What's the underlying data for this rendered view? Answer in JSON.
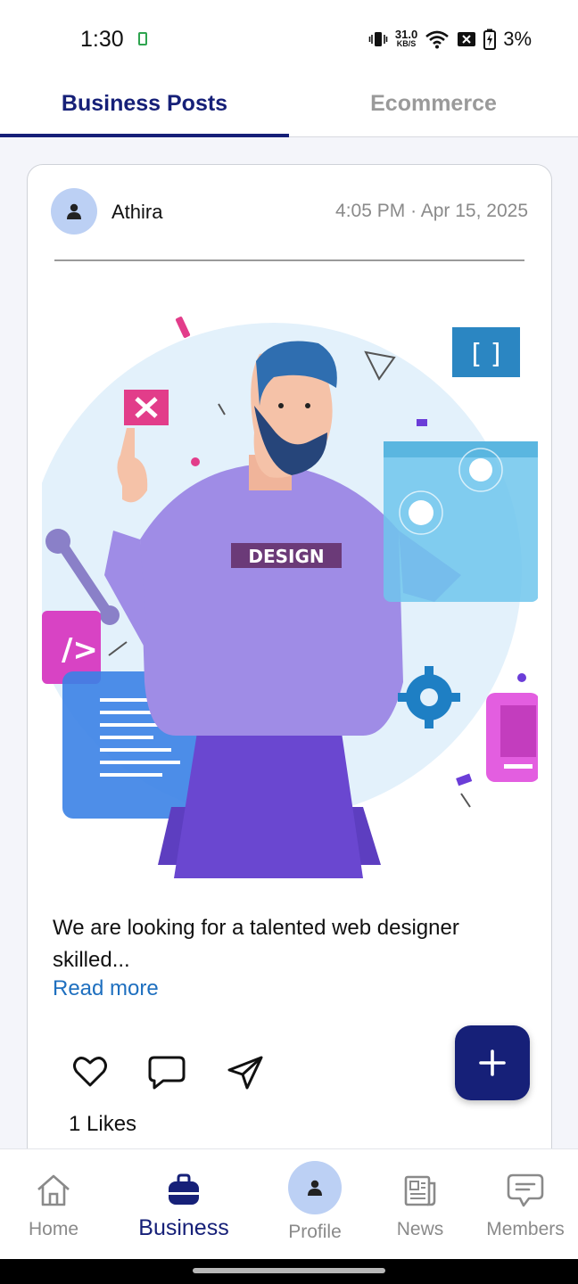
{
  "status_bar": {
    "time": "1:30",
    "net_speed_value": "31.0",
    "net_speed_unit": "KB/S",
    "battery": "3%"
  },
  "tabs": [
    {
      "label": "Business Posts",
      "active": true
    },
    {
      "label": "Ecommerce",
      "active": false
    }
  ],
  "post": {
    "author": "Athira",
    "timestamp": "4:05 PM · Apr 15, 2025",
    "image_badge_text": "DESIGN",
    "body": "We are looking for a talented web designer skilled...",
    "read_more": "Read more",
    "likes": "1 Likes"
  },
  "fab": {
    "icon": "plus-icon"
  },
  "bottom_nav": [
    {
      "label": "Home",
      "icon": "home-icon",
      "active": false
    },
    {
      "label": "Business",
      "icon": "briefcase-icon",
      "active": true
    },
    {
      "label": "Profile",
      "icon": "profile-icon",
      "active": false
    },
    {
      "label": "News",
      "icon": "newspaper-icon",
      "active": false
    },
    {
      "label": "Members",
      "icon": "chat-icon",
      "active": false
    }
  ],
  "colors": {
    "primary": "#162078",
    "link": "#1e6fbf",
    "avatar_bg": "#bcd0f4",
    "inactive": "#8a8a8a"
  }
}
